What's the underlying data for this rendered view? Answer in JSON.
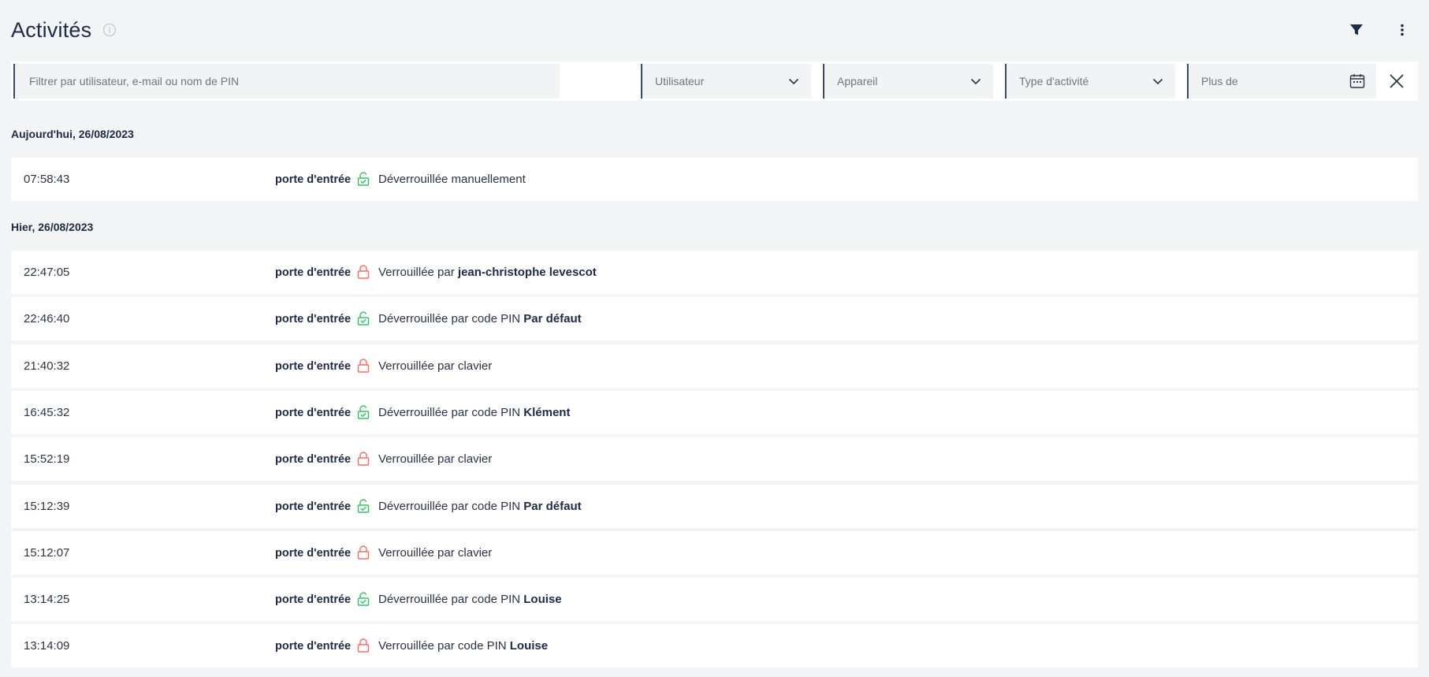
{
  "header": {
    "title": "Activités"
  },
  "filters": {
    "search_placeholder": "Filtrer par utilisateur, e-mail ou nom de PIN",
    "user_select": "Utilisateur",
    "device_select": "Appareil",
    "activity_type_select": "Type d'activité",
    "date_placeholder": "Plus de"
  },
  "groups": [
    {
      "label": "Aujourd'hui, 26/08/2023",
      "rows": [
        {
          "time": "07:58:43",
          "device": "porte d'entrée",
          "status": "unlocked",
          "action": "Déverrouillée manuellement",
          "actor": ""
        }
      ]
    },
    {
      "label": "Hier, 26/08/2023",
      "rows": [
        {
          "time": "22:47:05",
          "device": "porte d'entrée",
          "status": "locked",
          "action": "Verrouillée par",
          "actor": "jean-christophe levescot"
        },
        {
          "time": "22:46:40",
          "device": "porte d'entrée",
          "status": "unlocked",
          "action": "Déverrouillée par code PIN",
          "actor": "Par défaut"
        },
        {
          "time": "21:40:32",
          "device": "porte d'entrée",
          "status": "locked",
          "action": "Verrouillée par clavier",
          "actor": ""
        },
        {
          "time": "16:45:32",
          "device": "porte d'entrée",
          "status": "unlocked",
          "action": "Déverrouillée par code PIN",
          "actor": "Klément"
        },
        {
          "time": "15:52:19",
          "device": "porte d'entrée",
          "status": "locked",
          "action": "Verrouillée par clavier",
          "actor": ""
        },
        {
          "time": "15:12:39",
          "device": "porte d'entrée",
          "status": "unlocked",
          "action": "Déverrouillée par code PIN",
          "actor": "Par défaut"
        },
        {
          "time": "15:12:07",
          "device": "porte d'entrée",
          "status": "locked",
          "action": "Verrouillée par clavier",
          "actor": ""
        },
        {
          "time": "13:14:25",
          "device": "porte d'entrée",
          "status": "unlocked",
          "action": "Déverrouillée par code PIN",
          "actor": "Louise"
        },
        {
          "time": "13:14:09",
          "device": "porte d'entrée",
          "status": "locked",
          "action": "Verrouillée par code PIN",
          "actor": "Louise"
        }
      ]
    }
  ],
  "icons": {
    "info": "info-icon",
    "filter": "filter-icon",
    "more": "more-vertical-icon",
    "chevron": "chevron-down-icon",
    "calendar": "calendar-icon",
    "close": "close-icon",
    "locked": "lock-closed-icon",
    "unlocked": "lock-open-check-icon"
  },
  "colors": {
    "locked": "#f0716f",
    "unlocked": "#3fbf6a",
    "text": "#1f2a44"
  }
}
